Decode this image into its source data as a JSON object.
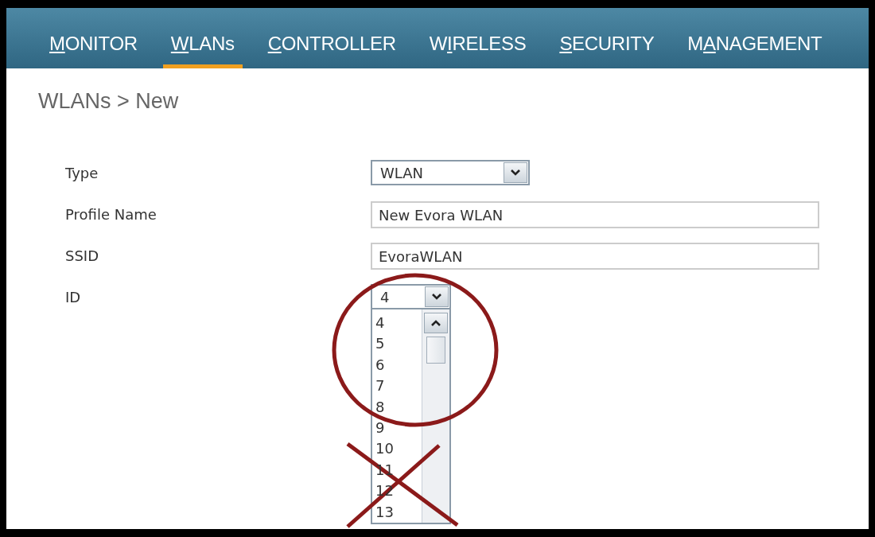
{
  "nav": [
    {
      "key": "M",
      "rest": "ONITOR",
      "selected": false
    },
    {
      "key": "W",
      "rest": "LANs",
      "selected": true
    },
    {
      "key": "C",
      "rest": "ONTROLLER",
      "selected": false
    },
    {
      "lead": "W",
      "key": "I",
      "rest": "RELESS",
      "selected": false
    },
    {
      "key": "S",
      "rest": "ECURITY",
      "selected": false
    },
    {
      "lead": "M",
      "key": "A",
      "rest": "NAGEMENT",
      "selected": false
    }
  ],
  "breadcrumb": "WLANs > New",
  "form": [
    {
      "label": "Type",
      "kind": "select",
      "value": "WLAN"
    },
    {
      "label": "Profile Name",
      "kind": "text",
      "value": "New Evora WLAN"
    },
    {
      "label": "SSID",
      "kind": "text",
      "value": "EvoraWLAN"
    },
    {
      "label": "ID",
      "kind": "select",
      "value": "4",
      "open": true,
      "options": [
        "4",
        "5",
        "6",
        "7",
        "8",
        "9",
        "10",
        "11",
        "12",
        "13"
      ]
    }
  ]
}
